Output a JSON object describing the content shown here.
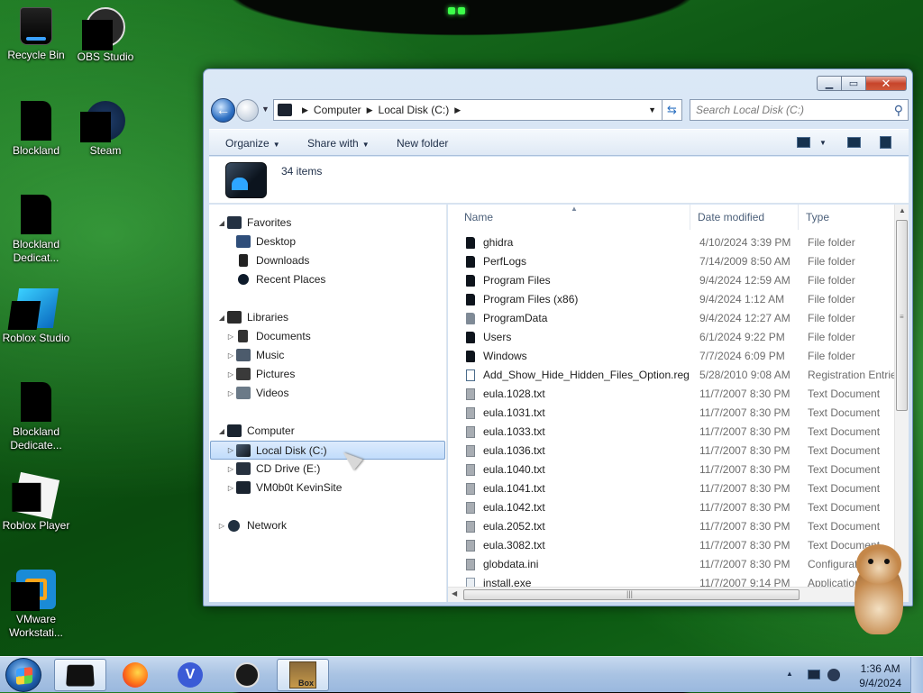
{
  "desktop": {
    "icons": [
      {
        "label": "Recycle Bin",
        "icon": "recycle-bin-icon"
      },
      {
        "label": "OBS Studio",
        "icon": "obs-studio-icon"
      },
      {
        "label": "Blockland",
        "icon": "blockland-icon"
      },
      {
        "label": "Steam",
        "icon": "steam-icon"
      },
      {
        "label": "Blockland Dedicat...",
        "icon": "blockland-dedicated-icon"
      },
      {
        "label": "Roblox Studio",
        "icon": "roblox-studio-icon"
      },
      {
        "label": "Blockland Dedicate...",
        "icon": "blockland-dedicated-2-icon"
      },
      {
        "label": "Roblox Player",
        "icon": "roblox-player-icon"
      },
      {
        "label": "VMware Workstati...",
        "icon": "vmware-workstation-icon"
      }
    ]
  },
  "window": {
    "address": {
      "segments": [
        "Computer",
        "Local Disk (C:)"
      ]
    },
    "search": {
      "placeholder": "Search Local Disk (C:)"
    },
    "commands": {
      "organize": "Organize",
      "share_with": "Share with",
      "new_folder": "New folder"
    },
    "details": {
      "item_count": "34 items"
    },
    "nav": {
      "favorites": "Favorites",
      "desktop": "Desktop",
      "downloads": "Downloads",
      "recent_places": "Recent Places",
      "libraries": "Libraries",
      "documents": "Documents",
      "music": "Music",
      "pictures": "Pictures",
      "videos": "Videos",
      "computer": "Computer",
      "local_disk": "Local Disk (C:)",
      "cd_drive": "CD Drive (E:)",
      "network_drive": "VM0b0t KevinSite",
      "network": "Network"
    },
    "columns": {
      "name": "Name",
      "date_modified": "Date modified",
      "type": "Type"
    },
    "files": [
      {
        "name": "ghidra",
        "date": "4/10/2024 3:39 PM",
        "type": "File folder",
        "icon": "folder"
      },
      {
        "name": "PerfLogs",
        "date": "7/14/2009 8:50 AM",
        "type": "File folder",
        "icon": "folder"
      },
      {
        "name": "Program Files",
        "date": "9/4/2024 12:59 AM",
        "type": "File folder",
        "icon": "folder"
      },
      {
        "name": "Program Files (x86)",
        "date": "9/4/2024 1:12 AM",
        "type": "File folder",
        "icon": "folder"
      },
      {
        "name": "ProgramData",
        "date": "9/4/2024 12:27 AM",
        "type": "File folder",
        "icon": "folder-hidden"
      },
      {
        "name": "Users",
        "date": "6/1/2024 9:22 PM",
        "type": "File folder",
        "icon": "folder"
      },
      {
        "name": "Windows",
        "date": "7/7/2024 6:09 PM",
        "type": "File folder",
        "icon": "folder"
      },
      {
        "name": "Add_Show_Hide_Hidden_Files_Option.reg",
        "date": "5/28/2010 9:08 AM",
        "type": "Registration Entries",
        "icon": "reg"
      },
      {
        "name": "eula.1028.txt",
        "date": "11/7/2007 8:30 PM",
        "type": "Text Document",
        "icon": "txt"
      },
      {
        "name": "eula.1031.txt",
        "date": "11/7/2007 8:30 PM",
        "type": "Text Document",
        "icon": "txt"
      },
      {
        "name": "eula.1033.txt",
        "date": "11/7/2007 8:30 PM",
        "type": "Text Document",
        "icon": "txt"
      },
      {
        "name": "eula.1036.txt",
        "date": "11/7/2007 8:30 PM",
        "type": "Text Document",
        "icon": "txt"
      },
      {
        "name": "eula.1040.txt",
        "date": "11/7/2007 8:30 PM",
        "type": "Text Document",
        "icon": "txt"
      },
      {
        "name": "eula.1041.txt",
        "date": "11/7/2007 8:30 PM",
        "type": "Text Document",
        "icon": "txt"
      },
      {
        "name": "eula.1042.txt",
        "date": "11/7/2007 8:30 PM",
        "type": "Text Document",
        "icon": "txt"
      },
      {
        "name": "eula.2052.txt",
        "date": "11/7/2007 8:30 PM",
        "type": "Text Document",
        "icon": "txt"
      },
      {
        "name": "eula.3082.txt",
        "date": "11/7/2007 8:30 PM",
        "type": "Text Document",
        "icon": "txt"
      },
      {
        "name": "globdata.ini",
        "date": "11/7/2007 8:30 PM",
        "type": "Configuration settings",
        "icon": "txt"
      },
      {
        "name": "install.exe",
        "date": "11/7/2007 9:14 PM",
        "type": "Application",
        "icon": "exe"
      }
    ]
  },
  "taskbar": {
    "pinned": [
      {
        "icon": "windows-explorer-icon",
        "active": true
      },
      {
        "icon": "firefox-icon",
        "active": false
      },
      {
        "icon": "vivaldi-icon",
        "active": false,
        "glyph": "V"
      },
      {
        "icon": "obs-studio-icon",
        "active": false
      },
      {
        "icon": "box-app-icon",
        "active": false,
        "glyph": "Box"
      }
    ],
    "clock": {
      "time": "1:36 AM",
      "date": "9/4/2024"
    }
  },
  "colors": {
    "desktop_green": "#0f5a15",
    "selection_blue": "#c1dcfb",
    "taskbar_blue": "#a9c3e3",
    "close_red": "#c7442a"
  }
}
